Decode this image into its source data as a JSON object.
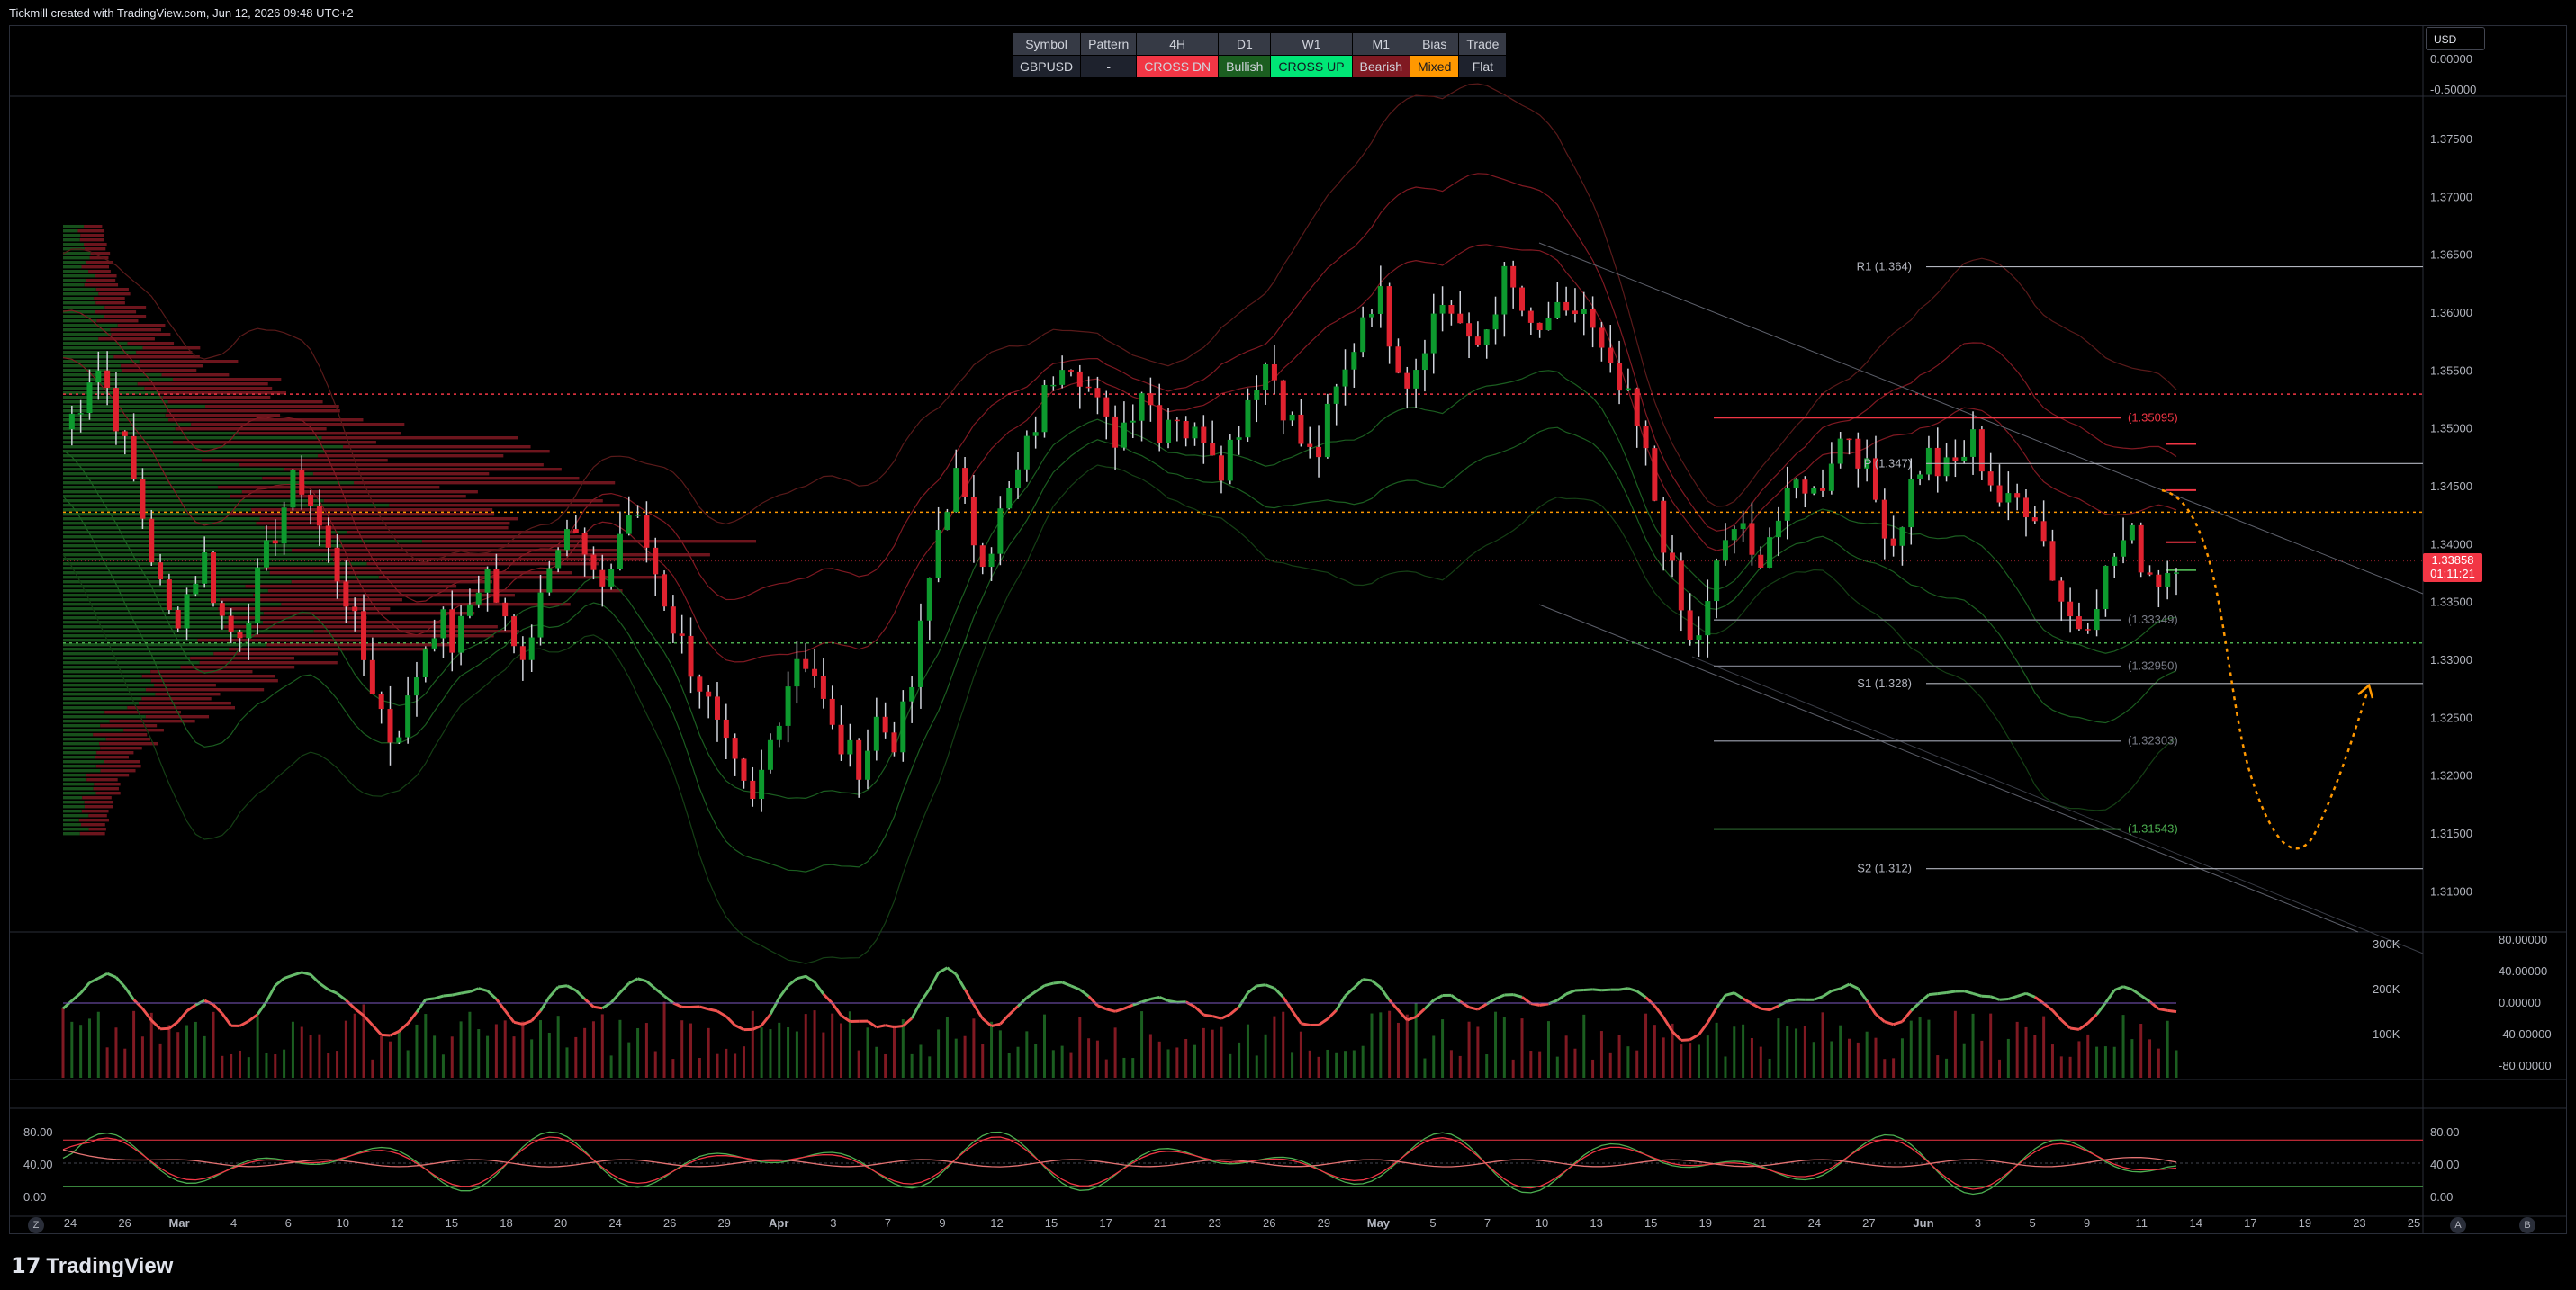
{
  "header": {
    "caption": "Tickmill created with TradingView.com, Jun 12, 2026 09:48 UTC+2"
  },
  "status_table": {
    "headers": [
      "Symbol",
      "Pattern",
      "4H",
      "D1",
      "W1",
      "M1",
      "Bias",
      "Trade"
    ],
    "values": [
      "GBPUSD",
      "-",
      "CROSS DN",
      "Bullish",
      "CROSS UP",
      "Bearish",
      "Mixed",
      "Flat"
    ],
    "colors": {
      "CROSS DN": "#f23645",
      "Bullish": "#1b5e20",
      "CROSS UP": "#00e676",
      "Bearish": "#801922",
      "Mixed": "#ff9800",
      "Flat": "#1e222d"
    }
  },
  "currency": "USD",
  "price_axis": {
    "labels": [
      "1.37500",
      "1.37000",
      "1.36500",
      "1.36000",
      "1.35500",
      "1.35000",
      "1.34500",
      "1.34000",
      "1.33500",
      "1.33000",
      "1.32500",
      "1.32000",
      "1.31500",
      "1.31000"
    ],
    "values": [
      1.375,
      1.37,
      1.365,
      1.36,
      1.355,
      1.35,
      1.345,
      1.34,
      1.335,
      1.33,
      1.325,
      1.32,
      1.315,
      1.31
    ]
  },
  "top_pane_axis": [
    "0.00000",
    "-0.50000"
  ],
  "current_price": {
    "value": "1.33858",
    "countdown": "01:11:21"
  },
  "pivot_levels": [
    {
      "label": "R1 (1.364)",
      "value": 1.364
    },
    {
      "label": "P (1.347)",
      "value": 1.347
    },
    {
      "label": "S1 (1.328)",
      "value": 1.328
    },
    {
      "label": "S2 (1.312)",
      "value": 1.312
    }
  ],
  "zone_levels": [
    {
      "label": "(1.35095)",
      "value": 1.35095,
      "color": "#f23645"
    },
    {
      "label": "(1.33349)",
      "value": 1.33349,
      "color": "#787b86"
    },
    {
      "label": "(1.32950)",
      "value": 1.3295,
      "color": "#787b86"
    },
    {
      "label": "(1.32303)",
      "value": 1.32303,
      "color": "#787b86"
    },
    {
      "label": "(1.31543)",
      "value": 1.31543,
      "color": "#4caf50"
    }
  ],
  "hlines": [
    {
      "value": 1.353,
      "color": "#f23645"
    },
    {
      "value": 1.3428,
      "color": "#ff9800"
    },
    {
      "value": 1.3315,
      "color": "#4caf50"
    }
  ],
  "time_axis": [
    "24",
    "26",
    "Mar",
    "4",
    "6",
    "10",
    "12",
    "15",
    "18",
    "20",
    "24",
    "26",
    "29",
    "Apr",
    "3",
    "7",
    "9",
    "12",
    "15",
    "17",
    "21",
    "23",
    "26",
    "29",
    "May",
    "5",
    "7",
    "10",
    "13",
    "15",
    "19",
    "21",
    "24",
    "27",
    "Jun",
    "3",
    "5",
    "9",
    "11",
    "14",
    "17",
    "19",
    "23",
    "25"
  ],
  "volume_axis": {
    "left": [
      "300K",
      "200K",
      "100K"
    ],
    "right": [
      "80.00000",
      "40.00000",
      "0.00000",
      "-40.00000",
      "-80.00000"
    ]
  },
  "stoch_axis": {
    "left": [
      "80.00",
      "40.00",
      "0.00"
    ],
    "right": [
      "80.00",
      "40.00",
      "0.00"
    ]
  },
  "footer": {
    "brand": "TradingView",
    "left_button": "Z",
    "right_buttons": [
      "A",
      "B"
    ]
  },
  "chart_data": {
    "type": "candlestick",
    "symbol": "GBPUSD",
    "ylim": [
      1.307,
      1.3785
    ],
    "close_path": [
      1.35,
      1.352,
      1.356,
      1.353,
      1.348,
      1.343,
      1.337,
      1.333,
      1.336,
      1.339,
      1.334,
      1.332,
      1.335,
      1.339,
      1.343,
      1.346,
      1.343,
      1.339,
      1.336,
      1.331,
      1.327,
      1.323,
      1.326,
      1.331,
      1.334,
      1.331,
      1.335,
      1.338,
      1.334,
      1.33,
      1.333,
      1.339,
      1.342,
      1.34,
      1.336,
      1.338,
      1.343,
      1.341,
      1.337,
      1.333,
      1.33,
      1.327,
      1.323,
      1.32,
      1.317,
      1.322,
      1.327,
      1.331,
      1.329,
      1.324,
      1.322,
      1.321,
      1.325,
      1.323,
      1.326,
      1.334,
      1.342,
      1.346,
      1.341,
      1.339,
      1.343,
      1.346,
      1.35,
      1.354,
      1.357,
      1.355,
      1.352,
      1.349,
      1.351,
      1.354,
      1.35,
      1.352,
      1.349,
      1.35,
      1.347,
      1.35,
      1.354,
      1.356,
      1.352,
      1.349,
      1.347,
      1.352,
      1.355,
      1.36,
      1.362,
      1.357,
      1.354,
      1.358,
      1.361,
      1.36,
      1.356,
      1.359,
      1.363,
      1.361,
      1.357,
      1.36,
      1.359,
      1.361,
      1.357,
      1.354,
      1.352,
      1.348,
      1.342,
      1.336,
      1.331,
      1.334,
      1.34,
      1.342,
      1.338,
      1.341,
      1.343,
      1.346,
      1.344,
      1.348,
      1.35,
      1.347,
      1.343,
      1.34,
      1.345,
      1.348,
      1.346,
      1.347,
      1.349,
      1.346,
      1.343,
      1.344,
      1.343,
      1.338,
      1.334,
      1.333,
      1.336,
      1.339,
      1.341,
      1.338,
      1.337,
      1.339
    ]
  }
}
